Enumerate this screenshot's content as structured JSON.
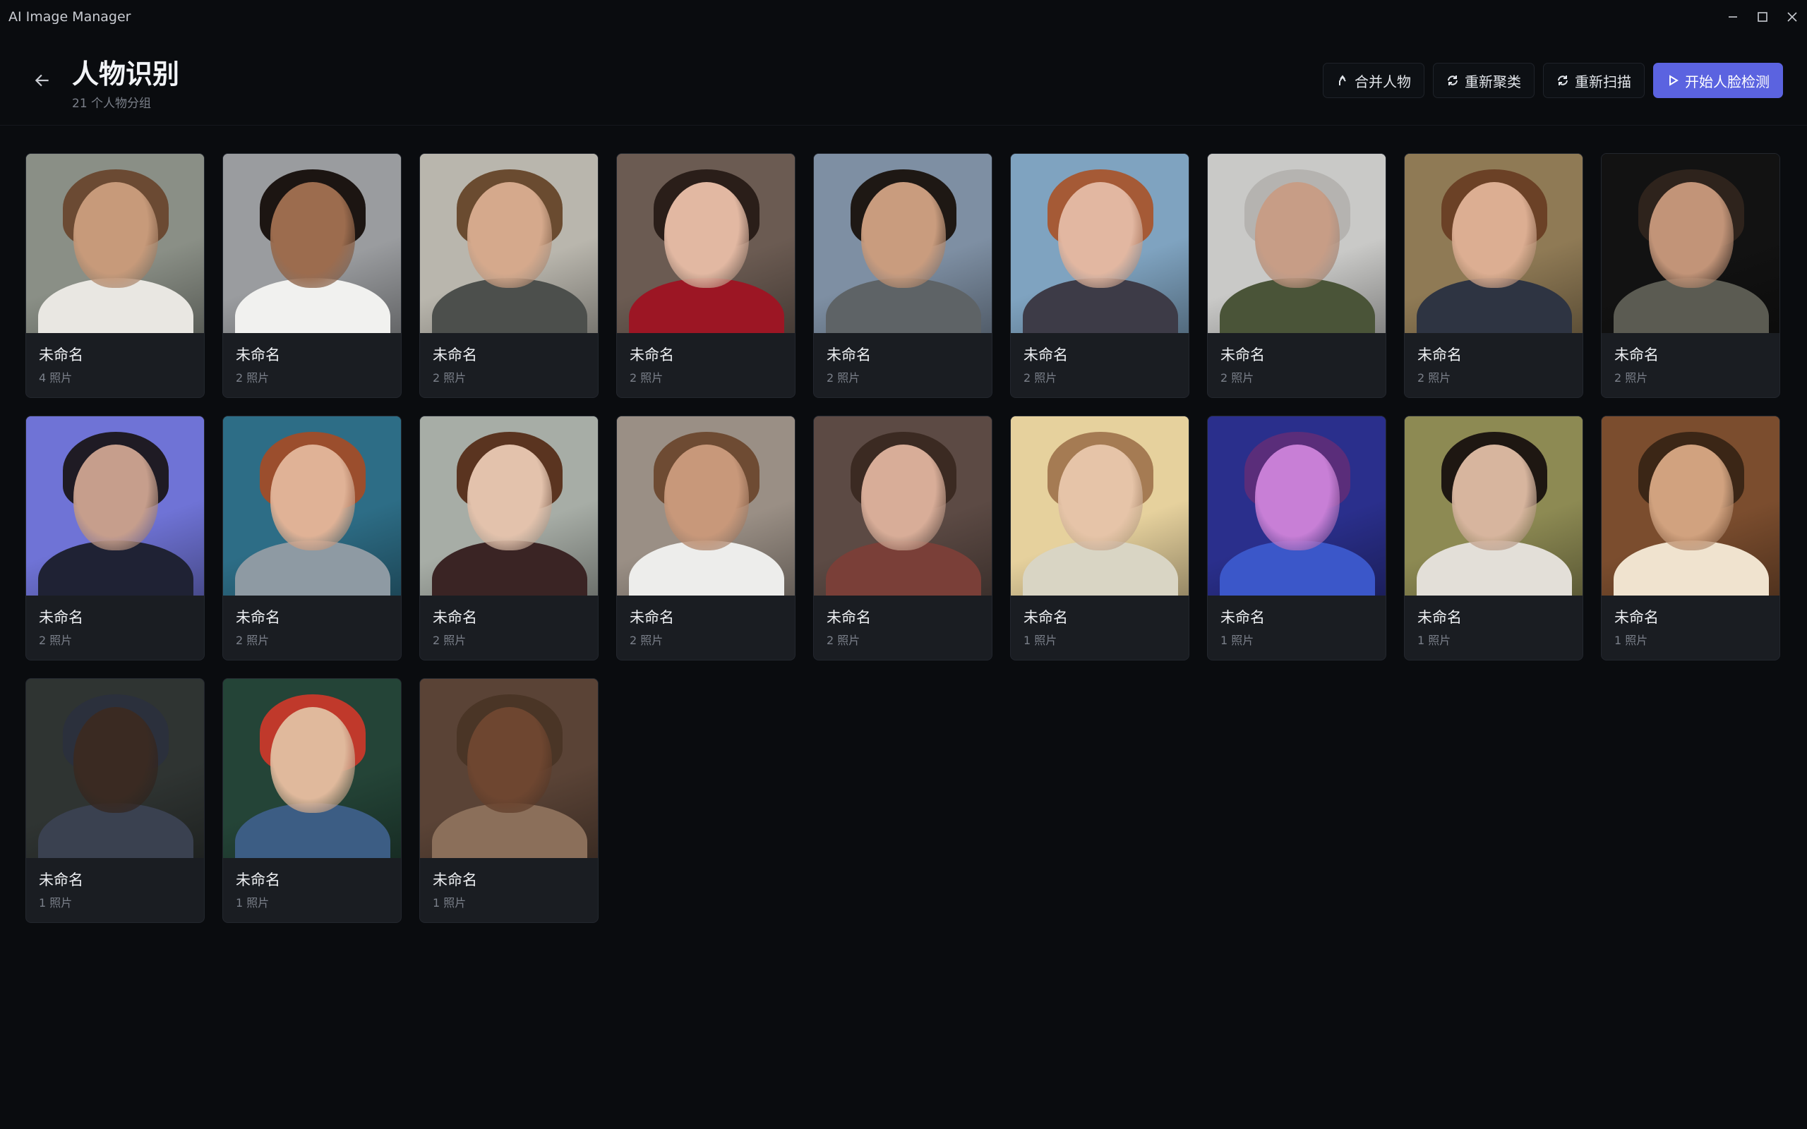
{
  "app": {
    "title": "AI Image Manager"
  },
  "header": {
    "title": "人物识别",
    "subtitle": "21 个人物分组",
    "actions": {
      "merge": "合并人物",
      "recluster": "重新聚类",
      "rescan": "重新扫描",
      "start": "开始人脸检测"
    }
  },
  "persons": [
    {
      "name": "未命名",
      "count": "4 照片",
      "bg": "#8a8f86",
      "skin": "#c79a7a",
      "hair": "#6b4a33",
      "cloth": "#e9e7e2"
    },
    {
      "name": "未命名",
      "count": "2 照片",
      "bg": "#9a9c9f",
      "skin": "#9c6c4e",
      "hair": "#1c1512",
      "cloth": "#f1f1ef"
    },
    {
      "name": "未命名",
      "count": "2 照片",
      "bg": "#b9b6ad",
      "skin": "#d5a98c",
      "hair": "#6a4b30",
      "cloth": "#4c4f4c"
    },
    {
      "name": "未命名",
      "count": "2 照片",
      "bg": "#6b5b52",
      "skin": "#e2b8a2",
      "hair": "#2a1e19",
      "cloth": "#9c1624"
    },
    {
      "name": "未命名",
      "count": "2 照片",
      "bg": "#7e8fa3",
      "skin": "#c99c7e",
      "hair": "#1e1814",
      "cloth": "#5e6366"
    },
    {
      "name": "未命名",
      "count": "2 照片",
      "bg": "#7fa3c0",
      "skin": "#e2b7a1",
      "hair": "#a55a36",
      "cloth": "#3d3b47"
    },
    {
      "name": "未命名",
      "count": "2 照片",
      "bg": "#c9c9c7",
      "skin": "#c79d86",
      "hair": "#b5b3b0",
      "cloth": "#4a5438"
    },
    {
      "name": "未命名",
      "count": "2 照片",
      "bg": "#8f7a55",
      "skin": "#dcae92",
      "hair": "#6b4126",
      "cloth": "#2e3442"
    },
    {
      "name": "未命名",
      "count": "2 照片",
      "bg": "#121212",
      "skin": "#c29478",
      "hair": "#2e231c",
      "cloth": "#5b5b52"
    },
    {
      "name": "未命名",
      "count": "2 照片",
      "bg": "#6f73d6",
      "skin": "#c69e8c",
      "hair": "#1f1b24",
      "cloth": "#1f2234"
    },
    {
      "name": "未命名",
      "count": "2 照片",
      "bg": "#2d6d86",
      "skin": "#e0b296",
      "hair": "#9b4e2d",
      "cloth": "#8e9aa3"
    },
    {
      "name": "未命名",
      "count": "2 照片",
      "bg": "#a7ada6",
      "skin": "#e3c2ac",
      "hair": "#5a3420",
      "cloth": "#3a2424"
    },
    {
      "name": "未命名",
      "count": "2 照片",
      "bg": "#9a8f85",
      "skin": "#c8987a",
      "hair": "#6e4b33",
      "cloth": "#ededeb"
    },
    {
      "name": "未命名",
      "count": "2 照片",
      "bg": "#5c4a44",
      "skin": "#d8ad98",
      "hair": "#3b2a22",
      "cloth": "#7a3f38"
    },
    {
      "name": "未命名",
      "count": "1 照片",
      "bg": "#e6d19d",
      "skin": "#e6c4a8",
      "hair": "#a57b53",
      "cloth": "#d9d5c4"
    },
    {
      "name": "未命名",
      "count": "1 照片",
      "bg": "#2a2f8c",
      "skin": "#c87fd6",
      "hair": "#5a2d7a",
      "cloth": "#3b57c9"
    },
    {
      "name": "未命名",
      "count": "1 照片",
      "bg": "#8d8a53",
      "skin": "#d7b59e",
      "hair": "#1e1712",
      "cloth": "#e3dfd8"
    },
    {
      "name": "未命名",
      "count": "1 照片",
      "bg": "#7b4d2e",
      "skin": "#d1a27f",
      "hair": "#3b2616",
      "cloth": "#f0e3cf"
    },
    {
      "name": "未命名",
      "count": "1 照片",
      "bg": "#2f3432",
      "skin": "#3a2a22",
      "hair": "#2b303c",
      "cloth": "#3a4150"
    },
    {
      "name": "未命名",
      "count": "1 照片",
      "bg": "#244437",
      "skin": "#e0b99c",
      "hair": "#c0392b",
      "cloth": "#3c5d84"
    },
    {
      "name": "未命名",
      "count": "1 照片",
      "bg": "#5a4336",
      "skin": "#6e4630",
      "hair": "#4a3526",
      "cloth": "#8b6f5a"
    }
  ]
}
